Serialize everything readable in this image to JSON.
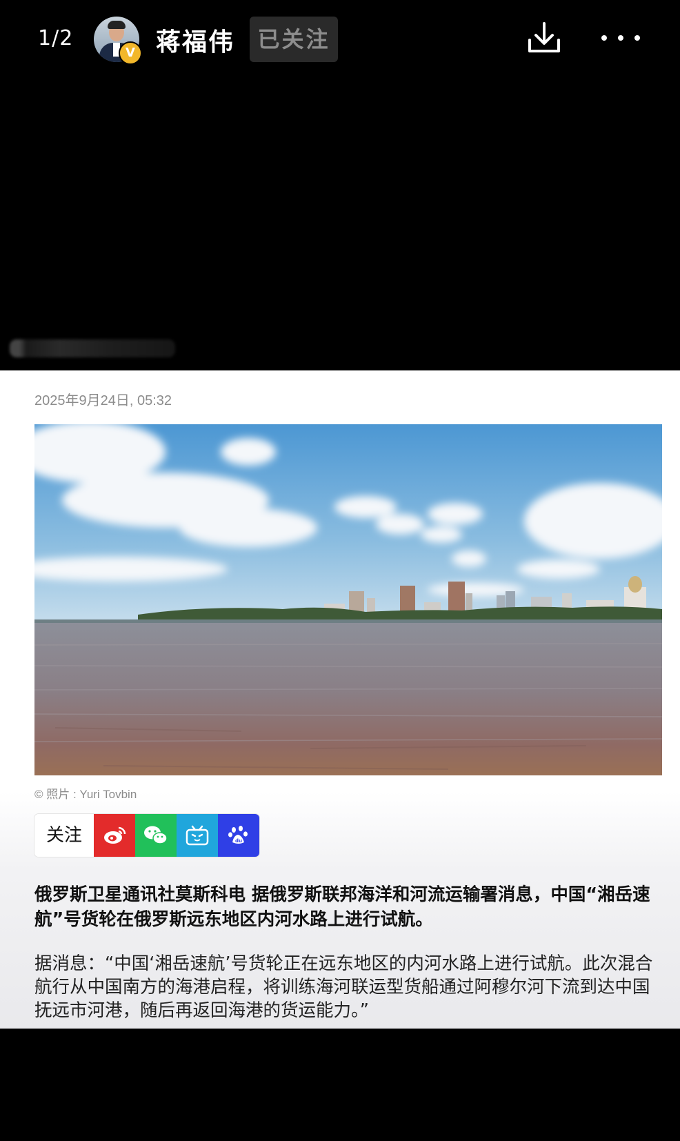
{
  "header": {
    "counter": "1/2",
    "username": "蒋福伟",
    "follow_label": "已关注",
    "verified_badge": "V"
  },
  "article": {
    "date": "2025年9月24日, 05:32",
    "photo_caption": "© 照片 : Yuri Tovbin",
    "share": {
      "follow_label": "关注",
      "icons": [
        "weibo-icon",
        "wechat-icon",
        "bilibili-icon",
        "baidu-icon"
      ],
      "colors": [
        "#e32b2b",
        "#21c05a",
        "#20a6dc",
        "#2f3fe6"
      ]
    },
    "para1": "俄罗斯卫星通讯社莫斯科电 据俄罗斯联邦海洋和河流运输署消息，中国“湘岳速航”号货轮在俄罗斯远东地区内河水路上进行试航。",
    "para2": "据消息：“中国‘湘岳速航’号货轮正在远东地区的内河水路上进行试航。此次混合航行从中国南方的海港启程，将训练海河联运型货船通过阿穆尔河下流到达中国抚远市河港，随后再返回海港的货运能力。”"
  },
  "colors": {
    "background": "#000000",
    "article_bg": "#ffffff",
    "muted_text": "#8c8c8c"
  }
}
